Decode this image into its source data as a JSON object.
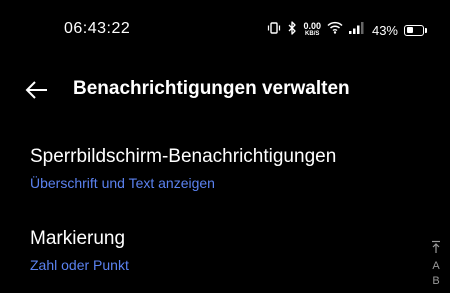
{
  "status_bar": {
    "time": "06:43:22",
    "net_speed_value": "0.00",
    "net_speed_unit": "KB/S",
    "battery_percent": "43%",
    "battery_level": 0.43
  },
  "header": {
    "title": "Benachrichtigungen verwalten"
  },
  "settings": [
    {
      "title": "Sperrbildschirm-Benachrichtigungen",
      "subtitle": "Überschrift und Text anzeigen"
    },
    {
      "title": "Markierung",
      "subtitle": "Zahl oder Punkt"
    }
  ],
  "index_bar": {
    "letters": [
      "A",
      "B"
    ]
  },
  "colors": {
    "background": "#000000",
    "accent": "#5b82f0",
    "text": "#ffffff"
  }
}
